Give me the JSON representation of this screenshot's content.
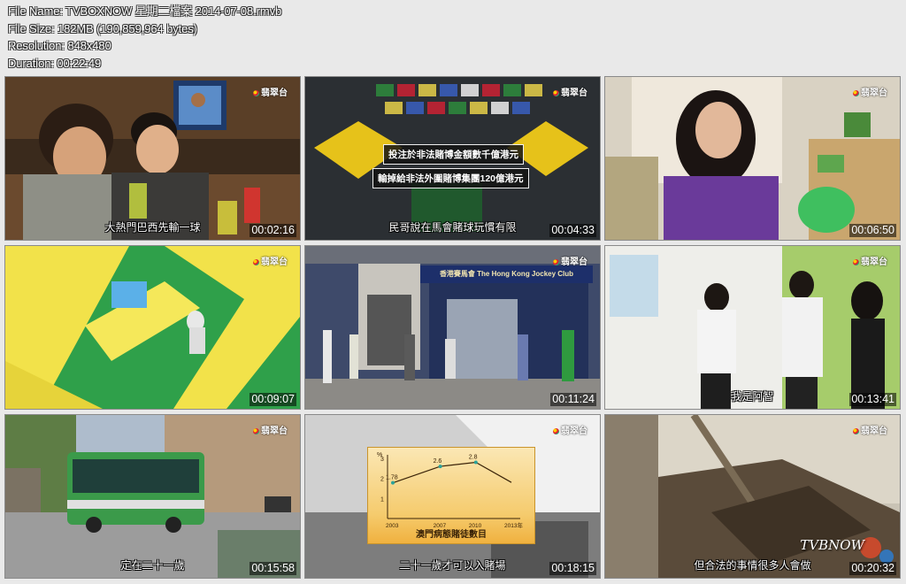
{
  "meta": {
    "file_name": "File Name: TVBOXNOW 星期二檔案 2014-07-08.rmvb",
    "file_size": "File Size: 182MB (190,859,964 bytes)",
    "resolution": "Resolution: 848x480",
    "duration": "Duration: 00:22:49"
  },
  "channel_logo": "翡翠台",
  "watermark": "TVBNOW",
  "thumbnails": [
    {
      "timestamp": "00:02:16",
      "subtitle": "大熱門巴西先輸一球"
    },
    {
      "timestamp": "00:04:33",
      "subtitle": "民哥說在馬會賭球玩慣有限",
      "caption_1": "投注於非法賭博金額數千億港元",
      "caption_2": "輸掉給非法外圍賭博集團120億港元"
    },
    {
      "timestamp": "00:06:50",
      "subtitle": ""
    },
    {
      "timestamp": "00:09:07",
      "subtitle": ""
    },
    {
      "timestamp": "00:11:24",
      "subtitle": "",
      "signboard": "香港賽馬會 The Hong Kong Jockey Club"
    },
    {
      "timestamp": "00:13:41",
      "subtitle": "我是阿智"
    },
    {
      "timestamp": "00:15:58",
      "subtitle": "定在二十一歲"
    },
    {
      "timestamp": "00:18:15",
      "subtitle": "二十一歲才可以入賭場",
      "chart_title": "澳門病態賭徒數目"
    },
    {
      "timestamp": "00:20:32",
      "subtitle": "但合法的事情很多人會做"
    }
  ],
  "chart_data": {
    "type": "line",
    "title": "澳門病態賭徒數目",
    "ylabel": "%",
    "x": [
      2003,
      2007,
      2010,
      2013
    ],
    "x_tick_labels": [
      "2003",
      "2007",
      "2010",
      "2013年"
    ],
    "values": [
      1.78,
      2.6,
      2.8,
      1.8
    ],
    "data_labels": [
      "1.78",
      "2.6",
      "2.8",
      ""
    ],
    "ylim": [
      0,
      3
    ],
    "y_ticks": [
      1,
      2,
      3
    ]
  }
}
